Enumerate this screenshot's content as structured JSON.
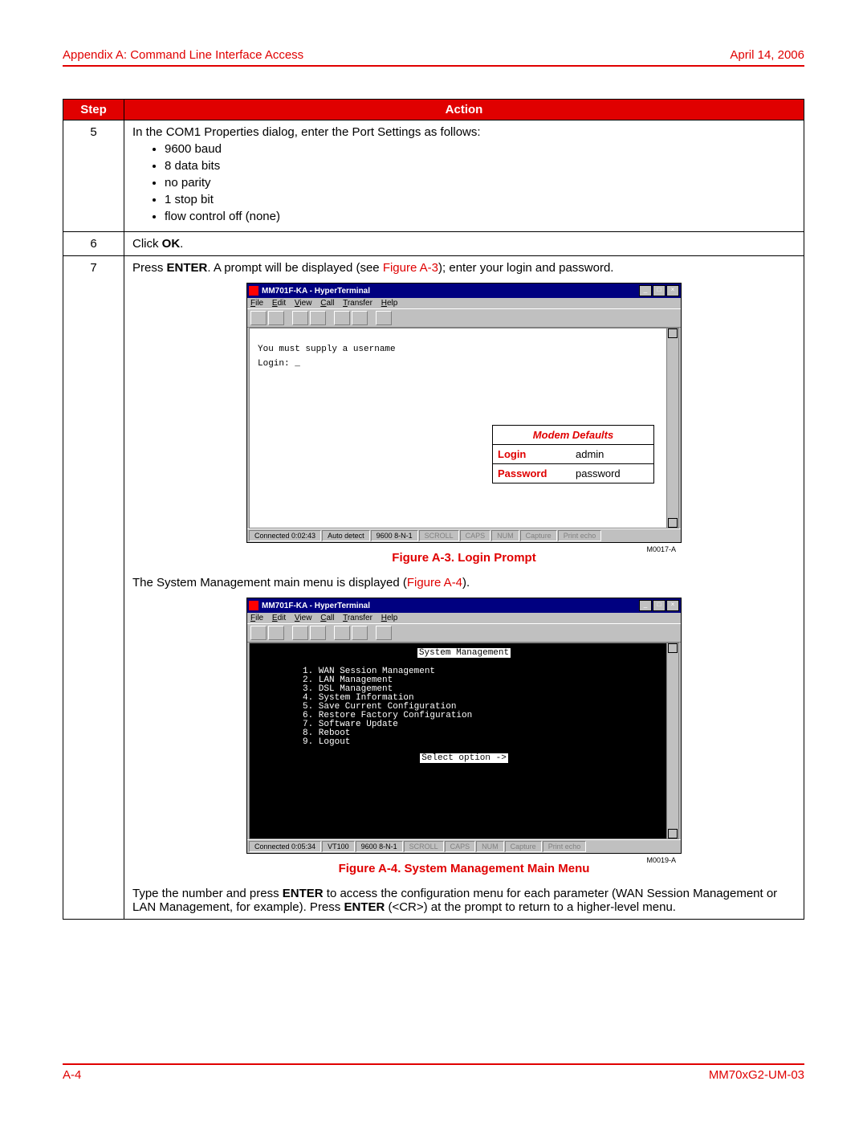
{
  "header": {
    "left": "Appendix A: Command Line Interface Access",
    "right": "April 14, 2006"
  },
  "table": {
    "head_step": "Step",
    "head_action": "Action",
    "row5": {
      "num": "5",
      "intro": "In the COM1 Properties dialog, enter the Port Settings as follows:",
      "b1": "9600 baud",
      "b2": "8 data bits",
      "b3": "no parity",
      "b4": "1 stop bit",
      "b5": "flow control off (none)"
    },
    "row6": {
      "num": "6",
      "pre": "Click ",
      "bold": "OK",
      "post": "."
    },
    "row7": {
      "num": "7",
      "line1_a": "Press ",
      "line1_b": "ENTER",
      "line1_c": ". A prompt will be displayed (see ",
      "line1_link": "Figure A-3",
      "line1_d": "); enter your login and password.",
      "fig3_caption": "Figure A-3. Login Prompt",
      "sys_line_a": "The System Management main menu is displayed (",
      "sys_line_link": "Figure A-4",
      "sys_line_b": ").",
      "fig4_caption": "Figure A-4. System Management Main Menu",
      "final_a": "Type the number and press ",
      "final_b": "ENTER",
      "final_c": " to access the configuration menu for each parameter (WAN Session Management or LAN Management, for example). Press ",
      "final_d": "ENTER",
      "final_e": " (<CR>) at the prompt to return to a higher-level menu."
    }
  },
  "ht": {
    "title": "MM701F-KA - HyperTerminal",
    "menu_file": "File",
    "menu_edit": "Edit",
    "menu_view": "View",
    "menu_call": "Call",
    "menu_transfer": "Transfer",
    "menu_help": "Help",
    "login_msg": "You must supply a username",
    "login_prompt": "Login: _",
    "status_conn1": "Connected 0:02:43",
    "status_auto": "Auto detect",
    "status_9600": "9600 8-N-1",
    "status_scroll": "SCROLL",
    "status_caps": "CAPS",
    "status_num": "NUM",
    "status_capture": "Capture",
    "status_print": "Print echo",
    "fig3_id": "M0017-A",
    "status_conn2": "Connected 0:05:34",
    "status_vt100": "VT100",
    "fig4_id": "M0019-A",
    "sm_title": "System Management",
    "sm_menu": "1. WAN Session Management\n2. LAN Management\n3. DSL Management\n4. System Information\n5. Save Current Configuration\n6. Restore Factory Configuration\n7. Software Update\n8. Reboot\n9. Logout",
    "sm_select": "Select option ->"
  },
  "defaults": {
    "title": "Modem Defaults",
    "login_label": "Login",
    "login_val": "admin",
    "pw_label": "Password",
    "pw_val": "password"
  },
  "footer": {
    "left": "A-4",
    "right": "MM70xG2-UM-03"
  }
}
